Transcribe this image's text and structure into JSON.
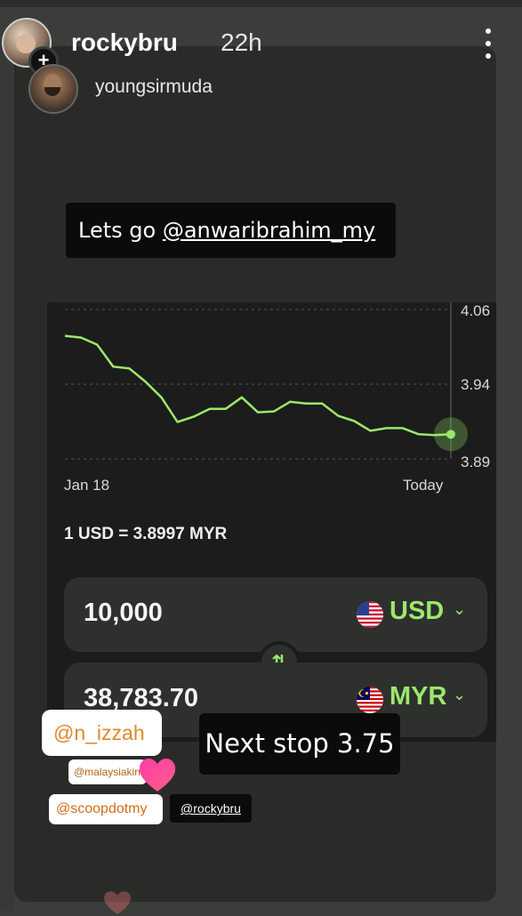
{
  "header": {
    "username": "rockybru",
    "time": "22h",
    "reposted_from": "youngsirmuda",
    "add_icon": "+"
  },
  "caption": {
    "prefix": "Lets go ",
    "mention": "@anwaribrahim_my"
  },
  "converter": {
    "chart_data": {
      "type": "line",
      "title": "",
      "x_labels": [
        "Jan 18",
        "Today"
      ],
      "y_ticks": [
        "4.06",
        "3.94",
        "3.89"
      ],
      "series": [
        {
          "values": [
            4.03,
            4.028,
            4.02,
            3.995,
            3.993,
            3.978,
            3.96,
            3.932,
            3.938,
            3.947,
            3.947,
            3.96,
            3.943,
            3.944,
            3.955,
            3.953,
            3.953,
            3.939,
            3.933,
            3.922,
            3.925,
            3.925,
            3.918,
            3.917,
            3.918
          ]
        }
      ],
      "line_color": "#9be86b"
    },
    "rate_text": "1 USD = 3.8997 MYR",
    "from": {
      "amount": "10,000",
      "currency": "USD",
      "flag": "us-flag-icon"
    },
    "to": {
      "amount": "38,783.70",
      "currency": "MYR",
      "flag": "my-flag-icon"
    },
    "swap_icon": "⇅",
    "chevron": "⌄"
  },
  "stickers": {
    "izzah": "@n_izzah",
    "malaysia": "@malaysiakini",
    "scoop": "@scoopdotmy",
    "rocky": "@rockybru",
    "next_stop": "Next stop 3.75"
  }
}
